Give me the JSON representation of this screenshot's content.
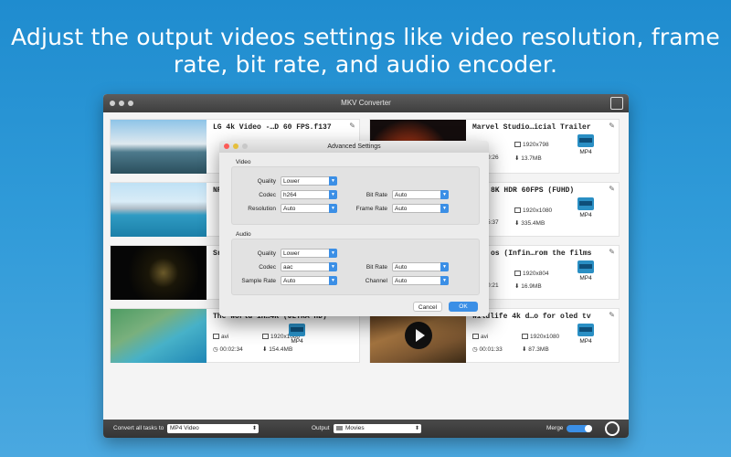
{
  "headline": "Adjust the output videos settings like video resolution, frame rate, bit rate, and audio encoder.",
  "window": {
    "title": "MKV Converter"
  },
  "cards": [
    {
      "title": "LG 4k Video -…D 60 FPS.f137",
      "meta1": "",
      "meta2": "",
      "format": "",
      "thumb_colors": [
        "#7fb7dd",
        "#4a6b7c"
      ]
    },
    {
      "title": "Marvel Studio…icial Trailer",
      "res": "1920x798",
      "time": "0:26",
      "size": "13.7MB",
      "format": "MP4",
      "thumb_colors": [
        "#1b1616",
        "#c55a1f"
      ]
    },
    {
      "title": "NP",
      "format": "",
      "thumb_colors": [
        "#8cc4ea",
        "#2e8fb8"
      ]
    },
    {
      "title": "8K HDR 60FPS (FUHD)",
      "res": "1920x1080",
      "time": "5:37",
      "size": "335.4MB",
      "format": "MP4",
      "thumb_colors": [
        "#e6e6e6",
        "#d2d2d2"
      ]
    },
    {
      "title": "Sr",
      "format": "",
      "thumb_colors": [
        "#0a0a0a",
        "#2a2414"
      ]
    },
    {
      "title": "os (Infin…rom the films",
      "res": "1920x804",
      "time": "0:21",
      "size": "16.9MB",
      "format": "MP4",
      "thumb_colors": [
        "#e6e6e6",
        "#d2d2d2"
      ]
    },
    {
      "title": "The World in…4K (ULTRA HD)",
      "codec": "avi",
      "res": "1920x1080",
      "time": "00:02:34",
      "size": "154.4MB",
      "format": "MP4",
      "thumb_colors": [
        "#5aa37c",
        "#2b86b8"
      ]
    },
    {
      "title": "Wildlife 4k d…o for oled tv",
      "codec": "avi",
      "res": "1920x1080",
      "time": "00:01:33",
      "size": "87.3MB",
      "format": "MP4",
      "thumb_colors": [
        "#6a4a2a",
        "#b77f45"
      ]
    }
  ],
  "bottombar": {
    "convert_all_label": "Convert all tasks to",
    "convert_all_value": "MP4 Video",
    "output_label": "Output",
    "output_value": "Movies",
    "merge_label": "Merge"
  },
  "dialog": {
    "title": "Advanced Settings",
    "video_label": "Video",
    "audio_label": "Audio",
    "video": {
      "quality_label": "Quality",
      "quality": "Lower",
      "codec_label": "Codec",
      "codec": "h264",
      "resolution_label": "Resolution",
      "resolution": "Auto",
      "bitrate_label": "Bit Rate",
      "bitrate": "Auto",
      "framerate_label": "Frame Rate",
      "framerate": "Auto"
    },
    "audio": {
      "quality_label": "Quality",
      "quality": "Lower",
      "codec_label": "Codec",
      "codec": "aac",
      "samplerate_label": "Sample Rate",
      "samplerate": "Auto",
      "bitrate_label": "Bit Rate",
      "bitrate": "Auto",
      "channel_label": "Channel",
      "channel": "Auto"
    },
    "cancel": "Cancel",
    "ok": "OK"
  },
  "colors": {
    "accent": "#3b8fe6",
    "bg_top": "#1f8ccf",
    "bg_bottom": "#4aa8e0"
  }
}
